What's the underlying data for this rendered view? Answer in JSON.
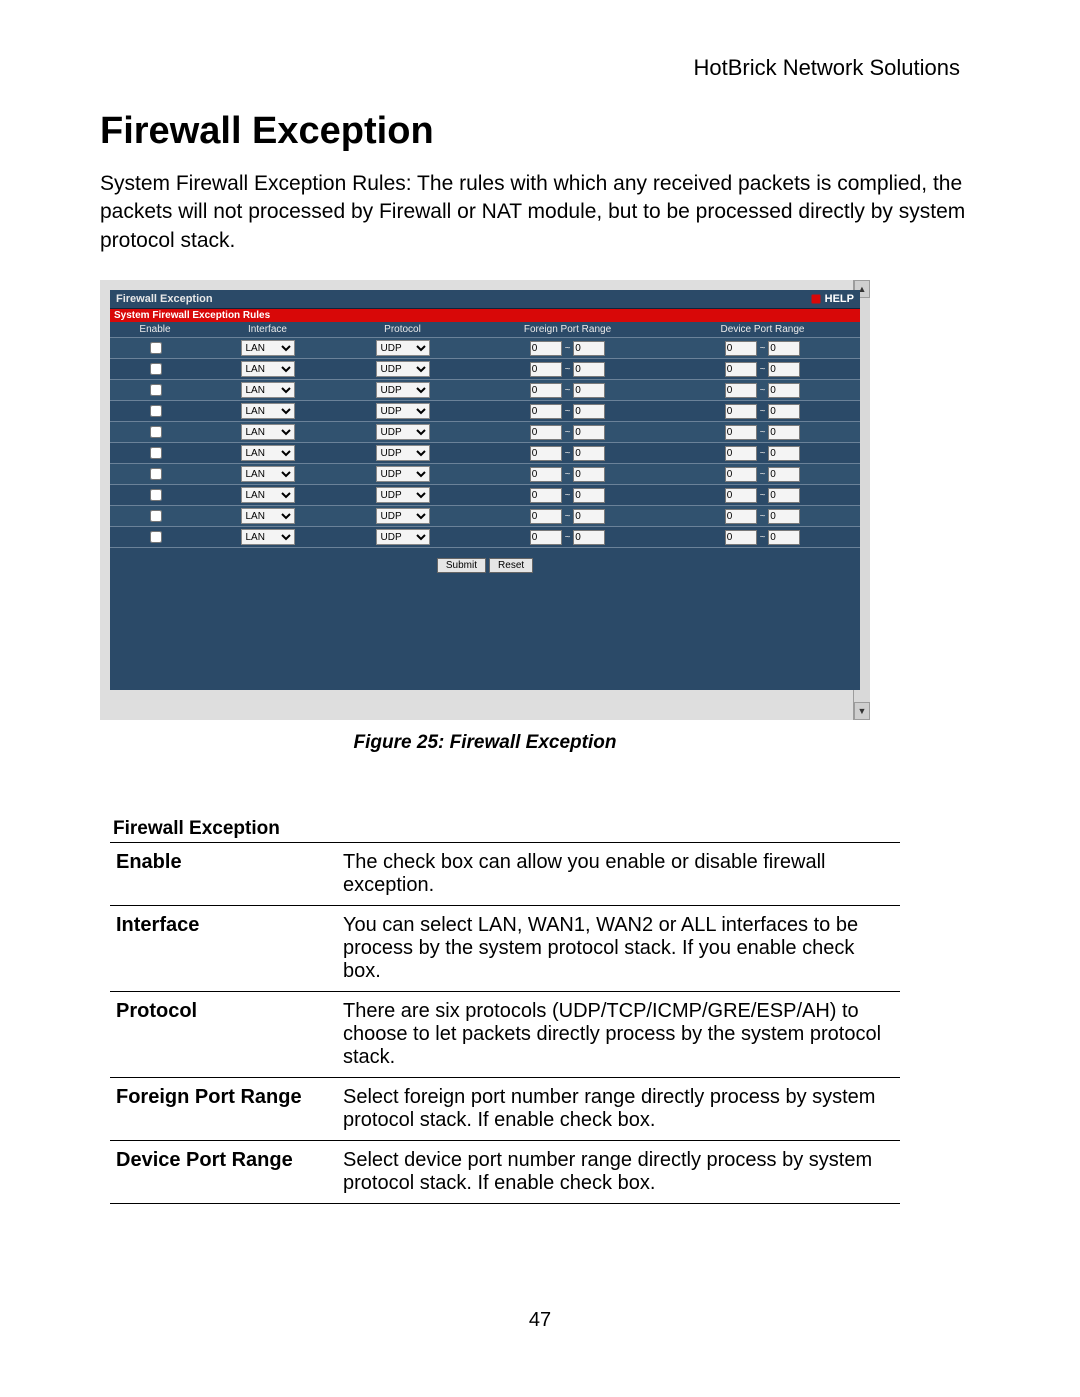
{
  "page_header": "HotBrick Network Solutions",
  "title": "Firewall Exception",
  "intro": "System Firewall Exception Rules: The rules with which any received packets is complied, the packets will not processed by Firewall or NAT module, but to be processed directly by system protocol stack.",
  "caption": "Figure 25: Firewall Exception",
  "page_number": "47",
  "panel": {
    "title": "Firewall Exception",
    "help": "HELP",
    "banner": "System Firewall Exception Rules",
    "columns": {
      "enable": "Enable",
      "interface": "Interface",
      "protocol": "Protocol",
      "foreign": "Foreign Port Range",
      "device": "Device Port Range"
    },
    "buttons": {
      "submit": "Submit",
      "reset": "Reset"
    },
    "interface_value": "LAN",
    "protocol_value": "UDP",
    "port_zero": "0",
    "port_dash": "~",
    "rows": 10
  },
  "def": {
    "section_title": "Firewall Exception",
    "rows": [
      {
        "k": "Enable",
        "v": "The check box can allow you enable or disable firewall exception."
      },
      {
        "k": "Interface",
        "v": "You can select LAN, WAN1, WAN2 or ALL interfaces to be process by the system protocol stack. If you enable check box."
      },
      {
        "k": "Protocol",
        "v": "There are six protocols (UDP/TCP/ICMP/GRE/ESP/AH) to choose to let packets directly process by the system protocol stack."
      },
      {
        "k": "Foreign Port Range",
        "v": "Select foreign port number range directly process by system protocol stack. If enable check box."
      },
      {
        "k": "Device Port Range",
        "v": "Select device port number range directly process by system protocol stack. If enable check box."
      }
    ]
  }
}
